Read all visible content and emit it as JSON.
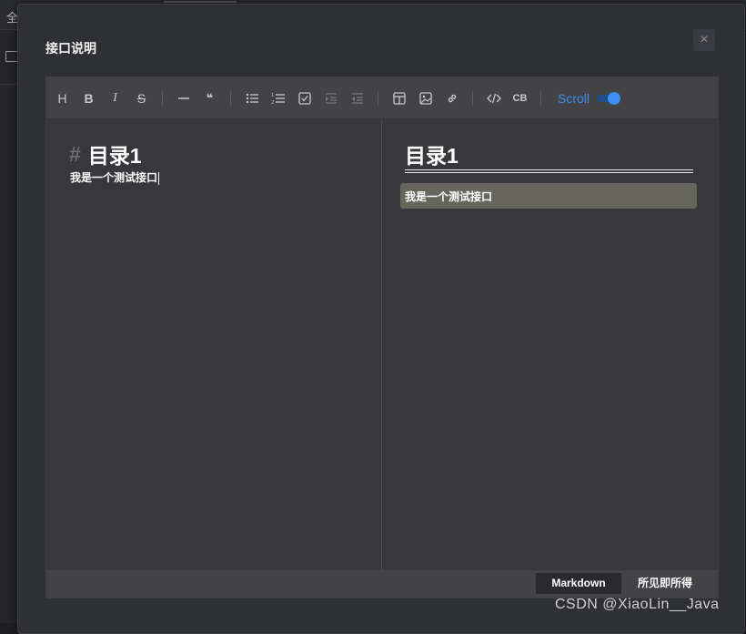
{
  "background": {
    "tab_text": "全"
  },
  "modal": {
    "title": "接口说明",
    "close_label": "×"
  },
  "toolbar": {
    "heading_label": "H",
    "bold_label": "B",
    "italic_label": "I",
    "strike_label": "S",
    "quote_label": "❝",
    "codeblock_label": "CB",
    "scroll_label": "Scroll",
    "scroll_enabled": true
  },
  "editor": {
    "heading_marker": "#",
    "heading_text": "目录1",
    "paragraph_text": "我是一个测试接口"
  },
  "preview": {
    "heading_text": "目录1",
    "paragraph_text": "我是一个测试接口"
  },
  "footer": {
    "markdown_tab": "Markdown",
    "wysiwyg_tab": "所见即所得",
    "active_tab": "Markdown"
  },
  "watermark": "CSDN @XiaoLin__Java",
  "colors": {
    "accent": "#3d8ef0",
    "editor_bg": "#37373c",
    "toolbar_bg": "#424247",
    "preview_highlight": "#66665c"
  }
}
